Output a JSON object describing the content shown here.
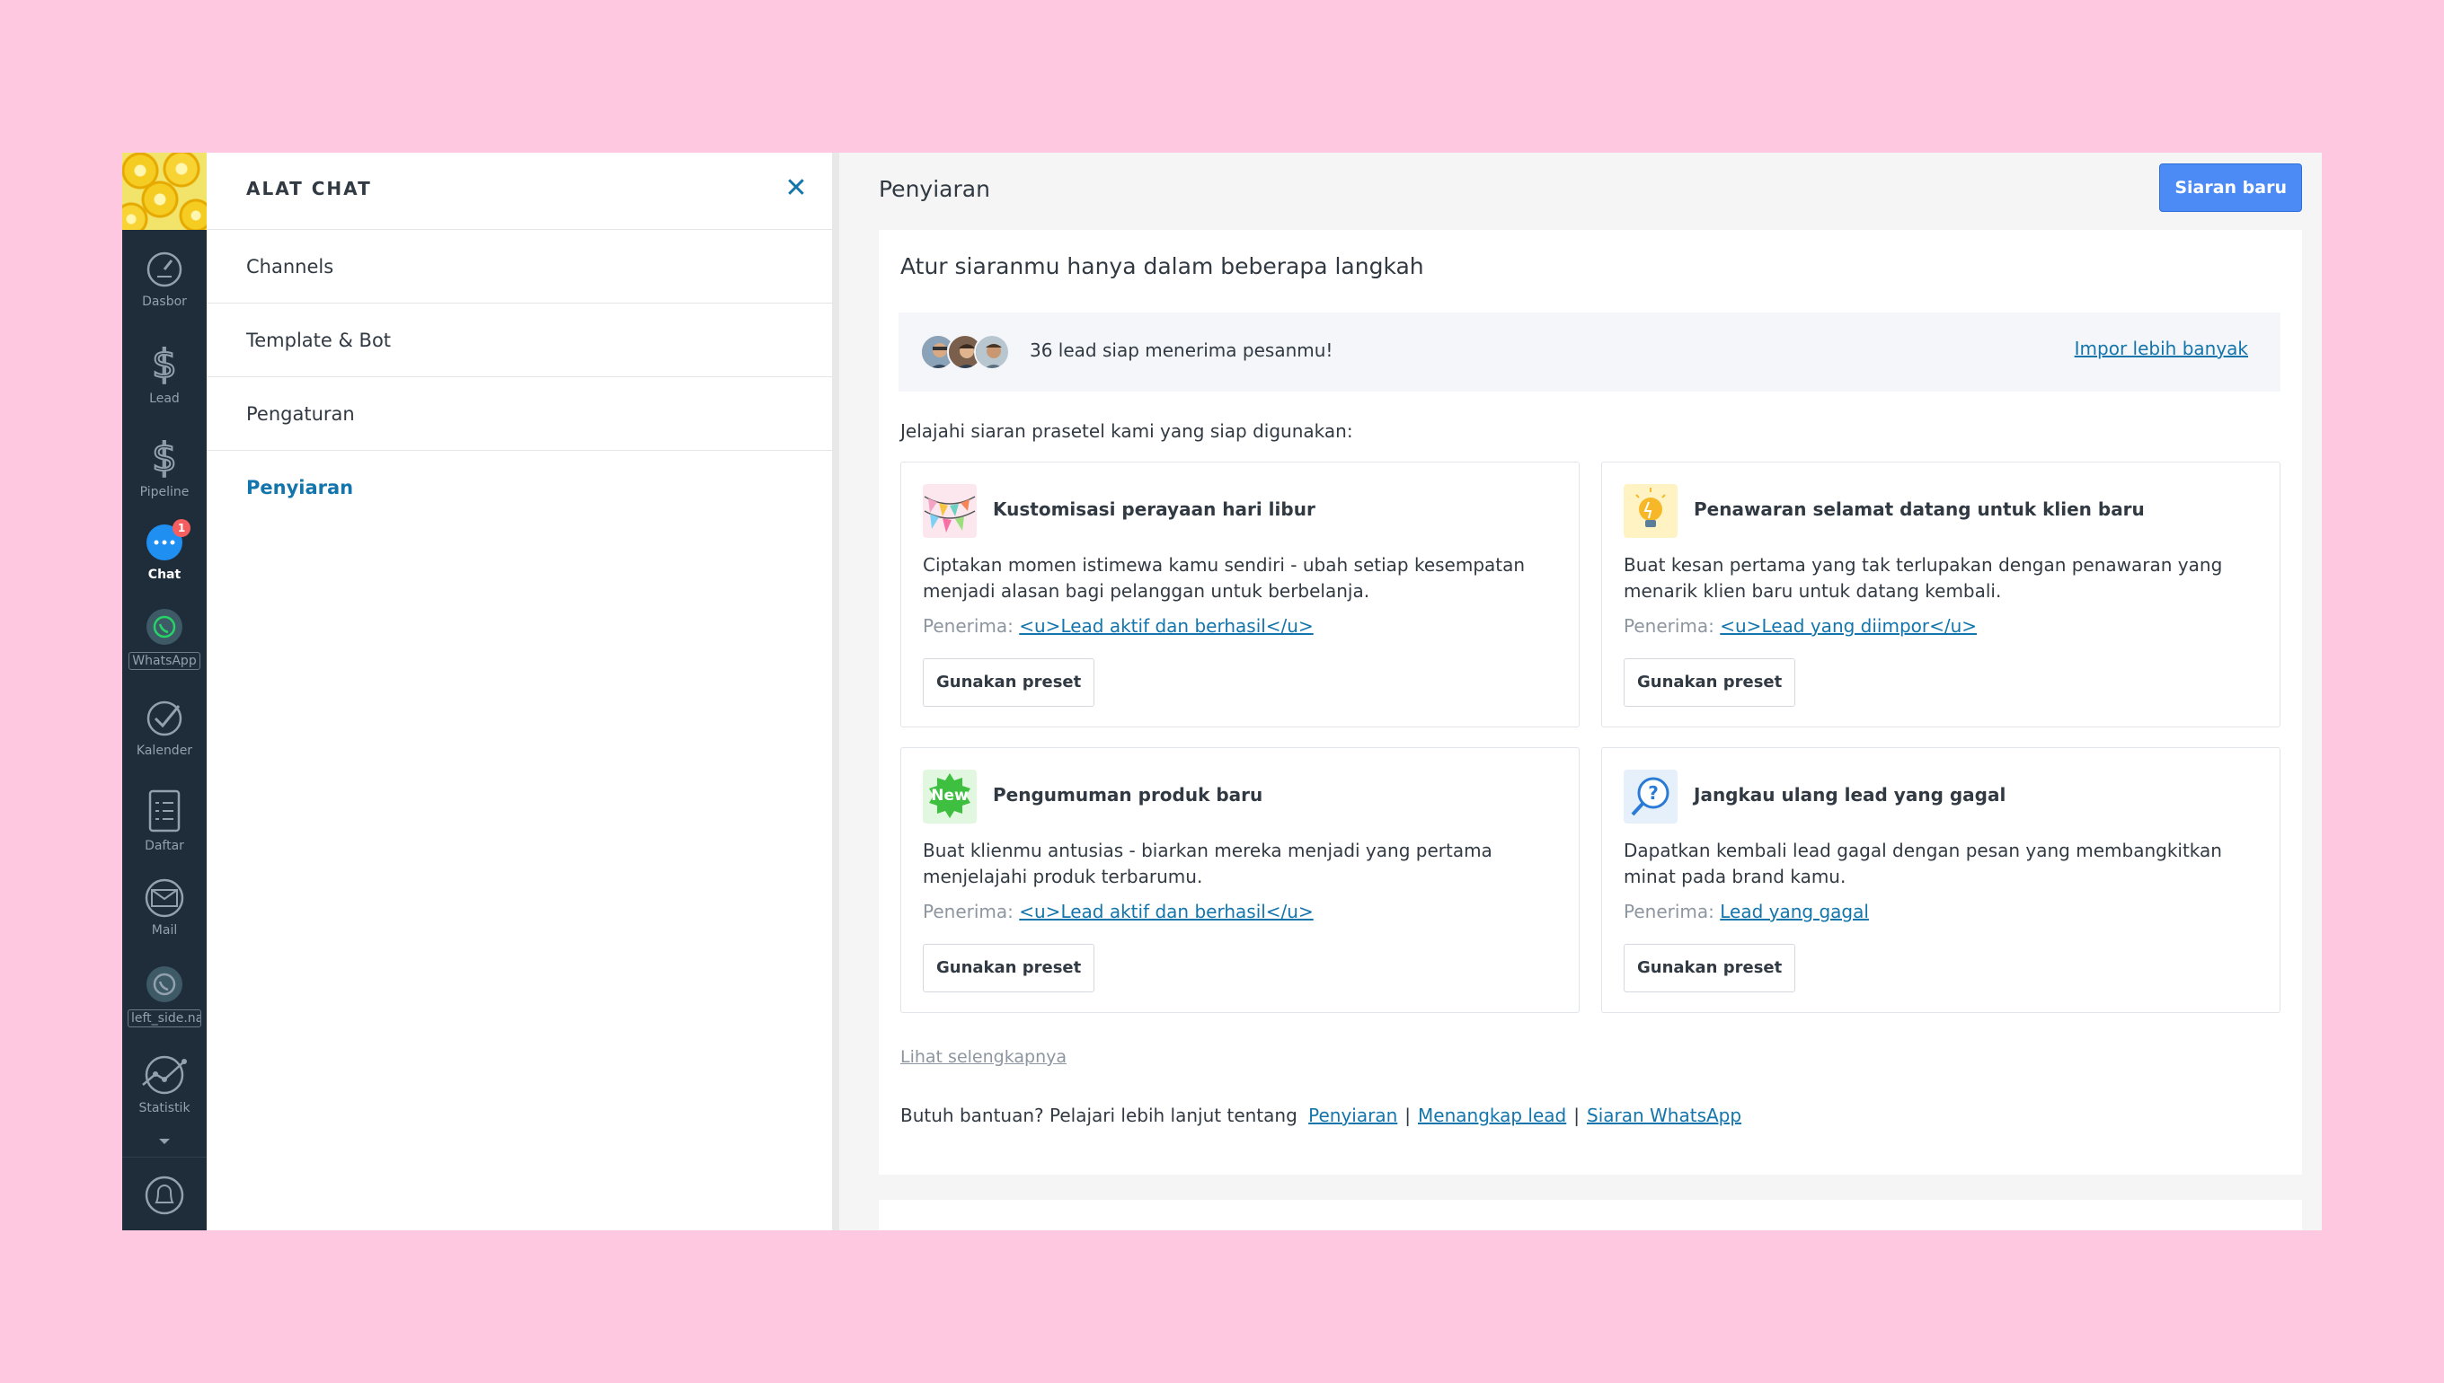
{
  "rail": {
    "items": [
      {
        "label": "Dasbor",
        "icon": "dashboard-icon"
      },
      {
        "label": "Lead",
        "icon": "dollar-icon"
      },
      {
        "label": "Pipeline",
        "icon": "dollar-icon"
      },
      {
        "label": "Chat",
        "icon": "chat-icon",
        "badge": "1"
      },
      {
        "label": "WhatsApp",
        "icon": "whatsapp-icon"
      },
      {
        "label": "Kalender",
        "icon": "check-icon"
      },
      {
        "label": "Daftar",
        "icon": "list-icon"
      },
      {
        "label": "Mail",
        "icon": "mail-icon"
      },
      {
        "label": "left_side.na",
        "icon": "whatsapp-icon"
      },
      {
        "label": "Statistik",
        "icon": "stats-icon"
      }
    ]
  },
  "panel": {
    "title": "ALAT CHAT",
    "items": [
      {
        "label": "Channels"
      },
      {
        "label": "Template & Bot"
      },
      {
        "label": "Pengaturan"
      },
      {
        "label": "Penyiaran"
      }
    ]
  },
  "main": {
    "title": "Penyiaran",
    "new_button": "Siaran baru",
    "card_title": "Atur siaranmu hanya dalam beberapa langkah",
    "leads_text": "36 lead siap menerima pesanmu!",
    "import_link": "Impor lebih banyak",
    "explore_text": "Jelajahi siaran prasetel kami yang siap digunakan:",
    "recipient_label": "Penerima:",
    "use_preset": "Gunakan preset",
    "presets": [
      {
        "title": "Kustomisasi perayaan hari libur",
        "desc": "Ciptakan momen istimewa kamu sendiri - ubah setiap kesempatan menjadi alasan bagi pelanggan untuk berbelanja.",
        "recipient": "<u>Lead aktif dan berhasil</u>",
        "icon": "party-flags-icon"
      },
      {
        "title": "Penawaran selamat datang untuk klien baru",
        "desc": "Buat kesan pertama yang tak terlupakan dengan penawaran yang menarik klien baru untuk datang kembali.",
        "recipient": "<u>Lead yang diimpor</u>",
        "icon": "lightbulb-icon"
      },
      {
        "title": "Pengumuman produk baru",
        "desc": "Buat klienmu antusias - biarkan mereka menjadi yang pertama menjelajahi produk terbarumu.",
        "recipient": "<u>Lead aktif dan berhasil</u>",
        "icon": "new-badge-icon",
        "icon_text": "New"
      },
      {
        "title": "Jangkau ulang lead yang gagal",
        "desc": "Dapatkan kembali lead gagal dengan pesan yang membangkitkan minat pada brand kamu.",
        "recipient": "Lead yang gagal",
        "icon": "question-search-icon"
      }
    ],
    "see_more": "Lihat selengkapnya",
    "help_text": "Butuh bantuan? Pelajari lebih lanjut tentang",
    "help_links": [
      "Penyiaran",
      "Menangkap lead",
      "Siaran WhatsApp"
    ],
    "help_sep": "|"
  },
  "colors": {
    "background": "#ffc8e1",
    "rail": "#1f2d3a",
    "accent": "#1375ab",
    "primary_button": "#4c8bf5"
  }
}
